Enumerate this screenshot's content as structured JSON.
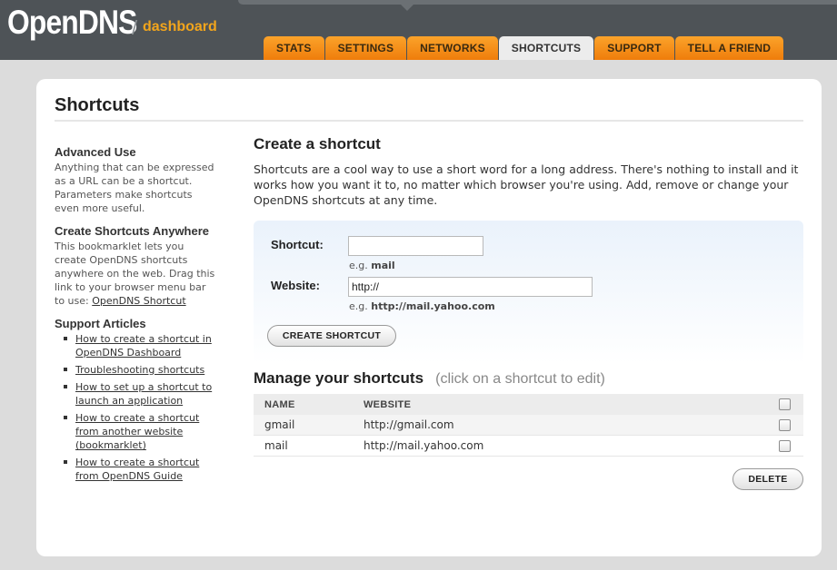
{
  "header": {
    "logo": "OpenDNS",
    "logo_slash": "/",
    "logo_sub": "dashboard",
    "tabs": [
      {
        "label": "STATS"
      },
      {
        "label": "SETTINGS"
      },
      {
        "label": "NETWORKS"
      },
      {
        "label": "SHORTCUTS"
      },
      {
        "label": "SUPPORT"
      },
      {
        "label": "TELL A FRIEND"
      }
    ],
    "active_tab": "SHORTCUTS"
  },
  "page": {
    "title": "Shortcuts"
  },
  "sidebar": {
    "advanced_heading": "Advanced Use",
    "advanced_text": "Anything that can be expressed as a URL can be a shortcut. Parameters make shortcuts even more useful.",
    "anywhere_heading": "Create Shortcuts Anywhere",
    "anywhere_text": "This bookmarklet lets you create OpenDNS shortcuts anywhere on the web. Drag this link to your browser menu bar to use:",
    "bookmarklet_link": "OpenDNS Shortcut",
    "support_heading": "Support Articles",
    "articles": [
      {
        "label": "How to create a shortcut in OpenDNS Dashboard"
      },
      {
        "label": "Troubleshooting shortcuts"
      },
      {
        "label": "How to set up a shortcut to launch an application"
      },
      {
        "label": "How to create a shortcut from another website (bookmarklet)"
      },
      {
        "label": "How to create a shortcut from OpenDNS Guide"
      }
    ]
  },
  "create": {
    "heading": "Create a shortcut",
    "intro": "Shortcuts are a cool way to use a short word for a long address. There's nothing to install and it works how you want it to, no matter which browser you're using. Add, remove or change your OpenDNS shortcuts at any time.",
    "shortcut_label": "Shortcut:",
    "shortcut_value": "",
    "shortcut_hint_prefix": "e.g.",
    "shortcut_hint_example": "mail",
    "website_label": "Website:",
    "website_value": "http://",
    "website_hint_prefix": "e.g.",
    "website_hint_example": "http://mail.yahoo.com",
    "button_label": "CREATE SHORTCUT"
  },
  "manage": {
    "heading": "Manage your shortcuts",
    "subheading": "(click on a shortcut to edit)",
    "columns": [
      "NAME",
      "WEBSITE"
    ],
    "rows": [
      {
        "name": "gmail",
        "website": "http://gmail.com",
        "checked": false
      },
      {
        "name": "mail",
        "website": "http://mail.yahoo.com",
        "checked": false
      }
    ],
    "delete_label": "DELETE"
  },
  "colors": {
    "header_bg": "#4e5357",
    "tab_orange": "#f08a14",
    "logo_sub": "#f2a51c",
    "page_bg": "#dcdcdc"
  }
}
